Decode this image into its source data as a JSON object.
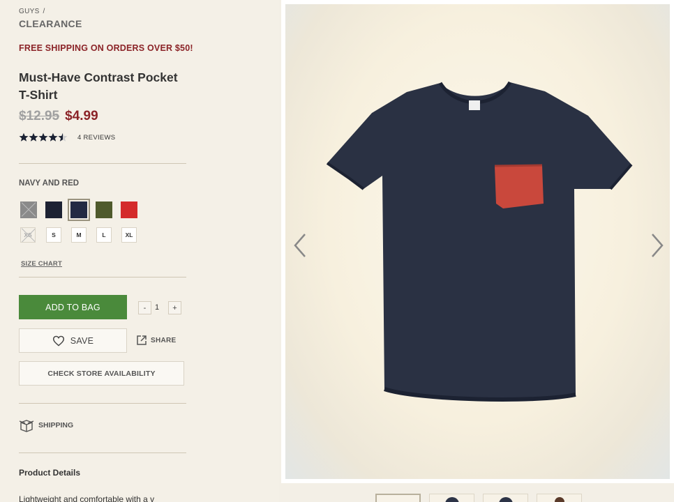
{
  "breadcrumb": {
    "parent": "GUYS",
    "separator": "/",
    "current": "CLEARANCE"
  },
  "promo": "FREE SHIPPING ON ORDERS OVER $50!",
  "product": {
    "title": "Must-Have Contrast Pocket T-Shirt",
    "price_original": "$12.95",
    "price_sale": "$4.99",
    "rating": 4.5,
    "reviews_label": "4 REVIEWS",
    "selected_color": "NAVY AND RED",
    "colors": [
      {
        "name": "heather grey",
        "hex": "#8a8a8a",
        "available": false
      },
      {
        "name": "navy",
        "hex": "#1d2233",
        "available": true
      },
      {
        "name": "navy and red",
        "hex": "#232a43",
        "available": true,
        "selected": true
      },
      {
        "name": "olive",
        "hex": "#4f5a2c",
        "available": true
      },
      {
        "name": "red",
        "hex": "#d42b2b",
        "available": true
      }
    ],
    "sizes": [
      {
        "label": "XS",
        "available": false
      },
      {
        "label": "S",
        "available": true
      },
      {
        "label": "M",
        "available": true
      },
      {
        "label": "L",
        "available": true
      },
      {
        "label": "XL",
        "available": true
      }
    ],
    "size_chart_label": "SIZE CHART",
    "quantity": "1",
    "qty_minus": "-",
    "qty_plus": "+"
  },
  "actions": {
    "add_to_bag": "ADD TO BAG",
    "save": "SAVE",
    "share": "SHARE",
    "check_store": "CHECK STORE AVAILABILITY",
    "shipping": "SHIPPING"
  },
  "details": {
    "heading": "Product Details",
    "text": "Lightweight and comfortable with a v"
  },
  "colors": {
    "accent_green": "#4a8a3b",
    "sale_red": "#8b2327"
  }
}
